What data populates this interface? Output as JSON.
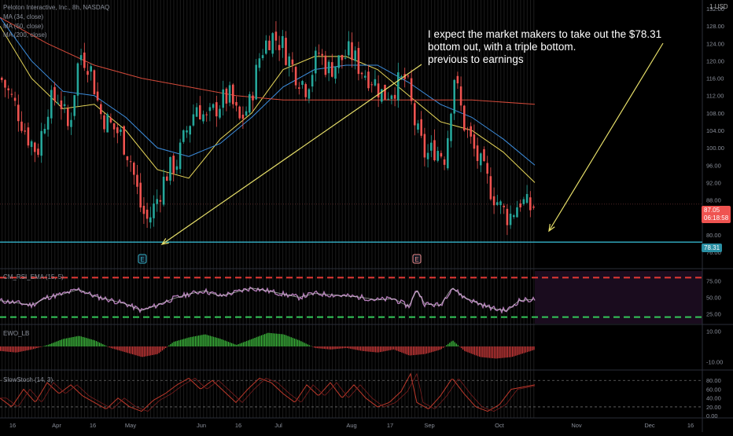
{
  "header": {
    "title": "Peloton Interactive, Inc., 8h, NASDAQ",
    "ma1": "MA (34, close)",
    "ma2": "MA (50, close)",
    "ma3": "MA (200, close)",
    "currency": "USD",
    "scale_mark": "1"
  },
  "annotation": {
    "line1": "I expect the market makers to take out the $78.31",
    "line2": "bottom out, with a triple bottom.",
    "line3": "previous to earnings"
  },
  "price_tag": {
    "price": "87.05",
    "countdown": "06:18:58"
  },
  "support_tag": "78.31",
  "earnings_marks": [
    "E",
    "E"
  ],
  "panes": {
    "rsi_label": "CM_RSI_EMA (15, 5)",
    "ewo_label": "EWO_LB",
    "stoch_label": "SlowStoch (14, 3)"
  },
  "colors": {
    "bull": "#26a69a",
    "bear": "#ef5350",
    "ma34": "#e8d85a",
    "ma50": "#3d8fe0",
    "ma200": "#d44a3a",
    "support": "#34b2c8",
    "arrow": "#e8e06a"
  },
  "chart_data": [
    {
      "type": "candlestick",
      "title": "Peloton Interactive, Inc., 8h, NASDAQ",
      "x_ticks": [
        "16",
        "Apr",
        "16",
        "May",
        "Jun",
        "16",
        "Jul",
        "Aug",
        "17",
        "Sep",
        "Oct",
        "Nov",
        "Dec",
        "16"
      ],
      "y_ticks": [
        76,
        80,
        84,
        88,
        92,
        96,
        100,
        104,
        108,
        112,
        116,
        120,
        124,
        128,
        132
      ],
      "ylim": [
        74,
        134
      ],
      "close_path": [
        [
          0,
          116
        ],
        [
          20,
          109
        ],
        [
          33,
          103
        ],
        [
          46,
          99
        ],
        [
          60,
          110
        ],
        [
          74,
          112
        ],
        [
          86,
          104
        ],
        [
          100,
          122
        ],
        [
          113,
          119
        ],
        [
          126,
          108
        ],
        [
          140,
          105
        ],
        [
          152,
          103
        ],
        [
          165,
          97
        ],
        [
          178,
          86
        ],
        [
          187,
          83
        ],
        [
          198,
          88
        ],
        [
          210,
          94
        ],
        [
          224,
          97
        ],
        [
          236,
          104
        ],
        [
          249,
          110
        ],
        [
          262,
          106
        ],
        [
          276,
          110
        ],
        [
          290,
          112
        ],
        [
          303,
          106
        ],
        [
          316,
          110
        ],
        [
          330,
          122
        ],
        [
          343,
          126
        ],
        [
          357,
          124
        ],
        [
          372,
          118
        ],
        [
          388,
          114
        ],
        [
          404,
          122
        ],
        [
          416,
          118
        ],
        [
          430,
          120
        ],
        [
          444,
          122
        ],
        [
          458,
          118
        ],
        [
          472,
          116
        ],
        [
          486,
          112
        ],
        [
          500,
          114
        ],
        [
          515,
          116
        ],
        [
          528,
          104
        ],
        [
          540,
          98
        ],
        [
          552,
          100
        ],
        [
          565,
          98
        ],
        [
          576,
          117
        ],
        [
          588,
          106
        ],
        [
          600,
          100
        ],
        [
          612,
          95
        ],
        [
          624,
          90
        ],
        [
          636,
          86
        ],
        [
          646,
          84
        ],
        [
          660,
          88
        ],
        [
          672,
          86
        ],
        [
          680,
          87
        ]
      ],
      "last_price": 87.05,
      "support_level": 78.31,
      "series": [
        {
          "name": "MA (34, close)",
          "values": [
            [
              0,
              128
            ],
            [
              40,
              116
            ],
            [
              80,
              109
            ],
            [
              120,
              110
            ],
            [
              160,
              104
            ],
            [
              200,
              95
            ],
            [
              240,
              93
            ],
            [
              280,
              102
            ],
            [
              320,
              108
            ],
            [
              360,
              118
            ],
            [
              400,
              121
            ],
            [
              440,
              121
            ],
            [
              480,
              118
            ],
            [
              520,
              112
            ],
            [
              560,
              106
            ],
            [
              600,
              104
            ],
            [
              640,
              99
            ],
            [
              680,
              92
            ]
          ]
        },
        {
          "name": "MA (50, close)",
          "values": [
            [
              0,
              130
            ],
            [
              40,
              120
            ],
            [
              80,
              113
            ],
            [
              120,
              112
            ],
            [
              160,
              107
            ],
            [
              200,
              100
            ],
            [
              240,
              98
            ],
            [
              280,
              101
            ],
            [
              320,
              107
            ],
            [
              360,
              114
            ],
            [
              400,
              118
            ],
            [
              440,
              119
            ],
            [
              480,
              119
            ],
            [
              520,
              115
            ],
            [
              560,
              110
            ],
            [
              600,
              107
            ],
            [
              640,
              102
            ],
            [
              680,
              96
            ]
          ]
        },
        {
          "name": "MA (200, close)",
          "values": [
            [
              0,
              130
            ],
            [
              60,
              124
            ],
            [
              120,
              119
            ],
            [
              180,
              116
            ],
            [
              240,
              114
            ],
            [
              300,
              112
            ],
            [
              360,
              111
            ],
            [
              420,
              111
            ],
            [
              480,
              111
            ],
            [
              540,
              111
            ],
            [
              600,
              111
            ],
            [
              680,
              110
            ]
          ]
        }
      ]
    },
    {
      "type": "line",
      "title": "CM_RSI_EMA (15, 5)",
      "y_ticks": [
        25,
        50,
        75
      ],
      "ylim": [
        10,
        90
      ],
      "bands": [
        80,
        20
      ],
      "values": [
        [
          0,
          45
        ],
        [
          20,
          42
        ],
        [
          40,
          38
        ],
        [
          60,
          50
        ],
        [
          80,
          55
        ],
        [
          100,
          62
        ],
        [
          120,
          52
        ],
        [
          140,
          46
        ],
        [
          160,
          40
        ],
        [
          180,
          30
        ],
        [
          200,
          38
        ],
        [
          220,
          48
        ],
        [
          240,
          55
        ],
        [
          260,
          60
        ],
        [
          280,
          52
        ],
        [
          300,
          58
        ],
        [
          320,
          64
        ],
        [
          340,
          60
        ],
        [
          360,
          55
        ],
        [
          380,
          50
        ],
        [
          400,
          56
        ],
        [
          420,
          54
        ],
        [
          440,
          52
        ],
        [
          460,
          50
        ],
        [
          480,
          46
        ],
        [
          500,
          48
        ],
        [
          520,
          36
        ],
        [
          530,
          62
        ],
        [
          540,
          40
        ],
        [
          560,
          38
        ],
        [
          575,
          65
        ],
        [
          590,
          50
        ],
        [
          610,
          40
        ],
        [
          630,
          32
        ],
        [
          645,
          30
        ],
        [
          660,
          45
        ],
        [
          680,
          47
        ]
      ]
    },
    {
      "type": "bar",
      "title": "EWO_LB",
      "y_ticks": [
        -10,
        10
      ],
      "ylim": [
        -14,
        14
      ],
      "values": [
        [
          0,
          -3
        ],
        [
          20,
          -4
        ],
        [
          40,
          -2
        ],
        [
          60,
          1
        ],
        [
          80,
          5
        ],
        [
          100,
          7
        ],
        [
          120,
          4
        ],
        [
          140,
          -1
        ],
        [
          160,
          -4
        ],
        [
          180,
          -7
        ],
        [
          200,
          -5
        ],
        [
          220,
          3
        ],
        [
          240,
          6
        ],
        [
          260,
          8
        ],
        [
          280,
          5
        ],
        [
          300,
          1
        ],
        [
          320,
          5
        ],
        [
          340,
          9
        ],
        [
          360,
          8
        ],
        [
          380,
          4
        ],
        [
          400,
          -1
        ],
        [
          420,
          -2
        ],
        [
          440,
          -1
        ],
        [
          460,
          -3
        ],
        [
          480,
          -4
        ],
        [
          500,
          -2
        ],
        [
          520,
          -6
        ],
        [
          540,
          -5
        ],
        [
          560,
          -2
        ],
        [
          575,
          4
        ],
        [
          590,
          -3
        ],
        [
          610,
          -7
        ],
        [
          630,
          -8
        ],
        [
          650,
          -7
        ],
        [
          680,
          -2
        ]
      ]
    },
    {
      "type": "line",
      "title": "SlowStoch (14, 3)",
      "y_ticks": [
        0,
        20,
        40,
        60,
        80
      ],
      "ylim": [
        -5,
        100
      ],
      "bands": [
        80,
        20
      ],
      "values": [
        [
          0,
          40
        ],
        [
          15,
          20
        ],
        [
          30,
          60
        ],
        [
          45,
          30
        ],
        [
          60,
          75
        ],
        [
          75,
          50
        ],
        [
          90,
          70
        ],
        [
          105,
          45
        ],
        [
          120,
          30
        ],
        [
          135,
          15
        ],
        [
          150,
          40
        ],
        [
          165,
          20
        ],
        [
          180,
          10
        ],
        [
          195,
          35
        ],
        [
          210,
          50
        ],
        [
          225,
          70
        ],
        [
          240,
          85
        ],
        [
          255,
          60
        ],
        [
          270,
          80
        ],
        [
          285,
          55
        ],
        [
          300,
          30
        ],
        [
          315,
          60
        ],
        [
          330,
          85
        ],
        [
          345,
          75
        ],
        [
          360,
          50
        ],
        [
          375,
          30
        ],
        [
          390,
          70
        ],
        [
          405,
          45
        ],
        [
          420,
          75
        ],
        [
          435,
          40
        ],
        [
          450,
          70
        ],
        [
          465,
          40
        ],
        [
          480,
          20
        ],
        [
          495,
          30
        ],
        [
          510,
          55
        ],
        [
          522,
          95
        ],
        [
          530,
          30
        ],
        [
          545,
          15
        ],
        [
          560,
          45
        ],
        [
          575,
          85
        ],
        [
          590,
          50
        ],
        [
          605,
          20
        ],
        [
          620,
          10
        ],
        [
          635,
          25
        ],
        [
          650,
          60
        ],
        [
          665,
          65
        ],
        [
          680,
          70
        ]
      ]
    }
  ]
}
